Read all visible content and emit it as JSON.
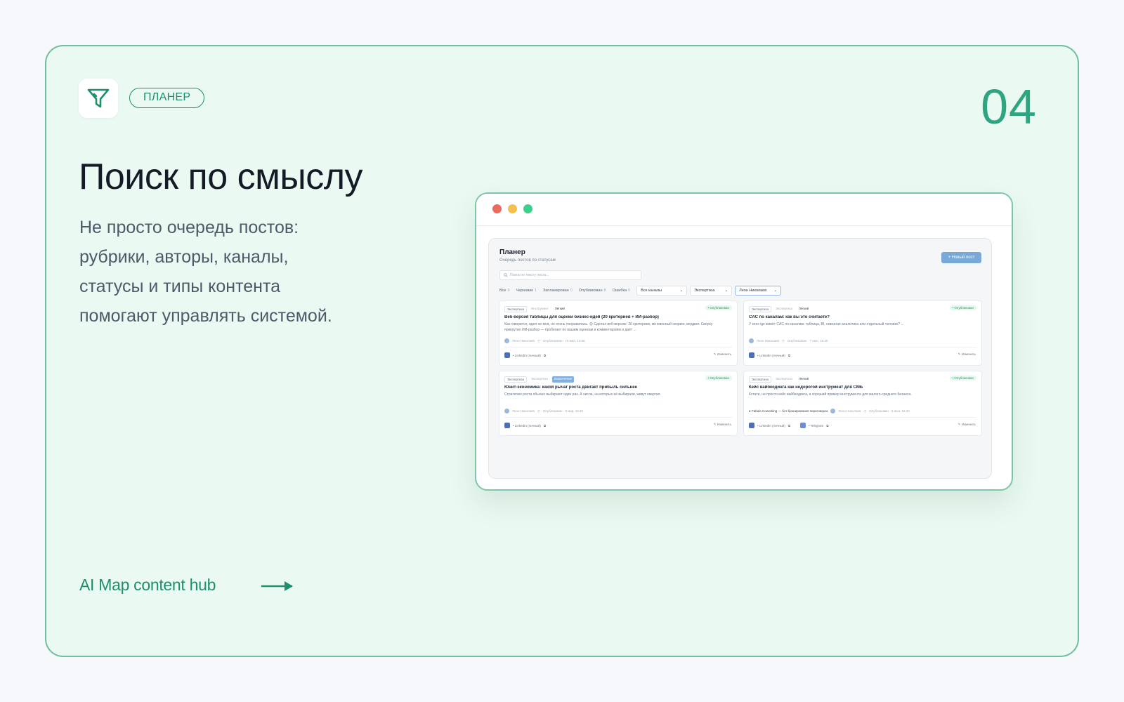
{
  "slide": {
    "tag": "ПЛАНЕР",
    "number": "04",
    "headline": "Поиск по смыслу",
    "subtext": "Не просто очередь постов: рубрики, авторы, каналы, статусы и типы контента помогают управлять системой.",
    "footer_link": "AI Map content hub",
    "accent_color": "#1e8f6e"
  },
  "app": {
    "title": "Планер",
    "subtitle": "Очередь постов по статусам",
    "new_post_label": "+ Новый пост",
    "search_placeholder": "Поиск по тексту поста...",
    "filter_tabs": [
      {
        "label": "Все",
        "count": "9"
      },
      {
        "label": "Черновик",
        "count": "1"
      },
      {
        "label": "Запланирован",
        "count": "0"
      },
      {
        "label": "Опубликован",
        "count": "8"
      },
      {
        "label": "Ошибка",
        "count": "0"
      }
    ],
    "selects": [
      "Все каналы",
      "Экспертиза",
      "Леон Николаев"
    ],
    "posts": [
      {
        "tags": [
          "Экспертиза",
          "Инструмент",
          "Лёгкий"
        ],
        "status": "• Опубликован",
        "title": "Веб-версия таблицы для оценки бизнес-идей (20 критериев + ИИ-разбор)",
        "body": "Как говорится, идея не моя, но очень понравилась. 😊 Сделал веб-версию: 20 критериев, мгновенный скоринг, вердикт. Сверху прикрутил ИИ-разбор — пробегает по вашим оценкам и комментариям и даёт ...",
        "author": "Леон Николаев",
        "published": "Опубликован · 15 мая, 12:56",
        "channels": [
          "• LinkedIn (личный)"
        ],
        "edit": "Изменить"
      },
      {
        "tags": [
          "Экспертиза",
          "Экспертиза",
          "Лёгкий"
        ],
        "status": "• Опубликован",
        "title": "CAC по каналам: как вы это считаете?",
        "body": "У кого где живёт CAC по каналам: таблица, BI, сквозная аналитика или отдельный человек? ...",
        "author": "Леон Николаев",
        "published": "Опубликован · 7 июн, 15:40",
        "channels": [
          "• LinkedIn (личный)"
        ],
        "edit": "Изменить"
      },
      {
        "tags": [
          "Экспертиза",
          "Экспертиза",
          "Вовлечение"
        ],
        "status": "• Опубликован",
        "title": "Юнит-экономика: какой рычаг роста двигает прибыль сильнее",
        "body": "Стратегию роста обычно выбирают один раз. А числа, на которых её выбирали, живут квартал.",
        "author": "Леон Николаев",
        "published": "Опубликован · 9 мар, 15:40",
        "channels": [
          "• LinkedIn (личный)"
        ],
        "edit": "Изменить"
      },
      {
        "tags": [
          "Экспертиза",
          "Экспертиза",
          "Лёгкий"
        ],
        "status": "• Опубликован",
        "title": "Кейс вайбкодинга как недорогой инструмент для СМБ",
        "body": "Кстати, не просто кейс вайбкодинга, а хороший пример инструмента для малого-среднего бизнеса.",
        "project": "Fabula Coworking — бот бронирования переговорок",
        "author": "Леон Николаев",
        "published": "Опубликован · 6 июн, 15:40",
        "channels": [
          "• LinkedIn (личный)",
          "• Telegram"
        ],
        "edit": "Изменить"
      }
    ]
  }
}
